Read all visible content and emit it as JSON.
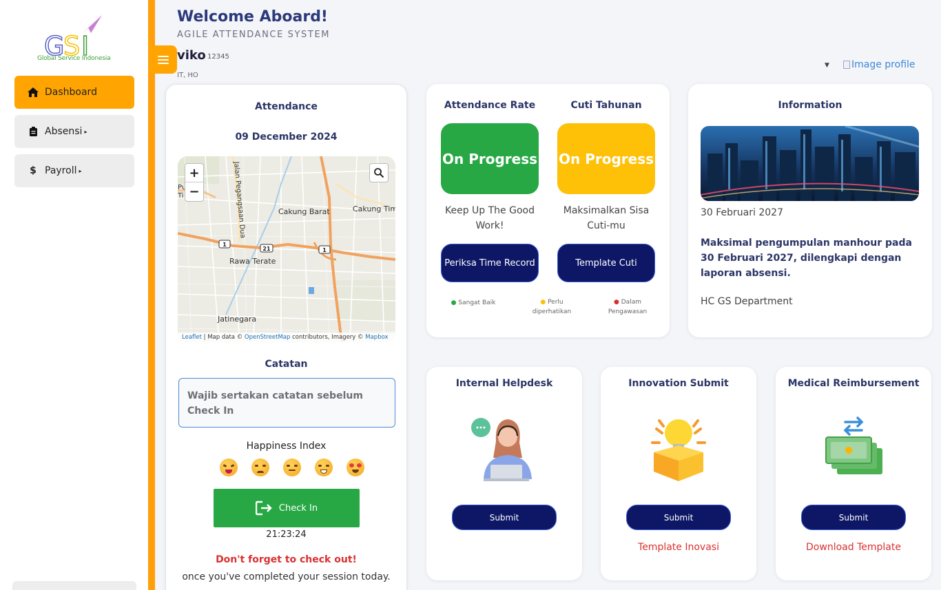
{
  "brand": {
    "logo_letters": "GSI",
    "logo_text": "Global Service Indonesia"
  },
  "sidebar": {
    "items": [
      {
        "label": "Dashboard",
        "icon": "home-icon",
        "active": true
      },
      {
        "label": "Absensi",
        "icon": "clipboard-icon",
        "has_submenu": true
      },
      {
        "label": "Payroll",
        "icon": "dollar-icon",
        "has_submenu": true
      }
    ],
    "caret": "▸"
  },
  "header": {
    "welcome": "Welcome Aboard!",
    "subtitle": "AGILE ATTENDANCE SYSTEM",
    "user_name": "viko",
    "user_id": "12345",
    "user_dept": "IT, HO",
    "profile_alt": "Image profile",
    "profile_caret": "▼"
  },
  "attendance": {
    "title": "Attendance",
    "date": "09 December 2024",
    "map": {
      "zoom_in": "+",
      "zoom_out": "−",
      "labels": [
        "Jalan Pegangsaan Dua",
        "Cakung Barat",
        "Cakung Tim",
        "Rawa Terate",
        "Jatinegara",
        "1",
        "21",
        "1",
        "1"
      ],
      "attribution_leaflet": "Leaflet",
      "attribution_mid": " | Map data © ",
      "attribution_osm": "OpenStreetMap",
      "attribution_mid2": " contributors, Imagery © ",
      "attribution_mapbox": "Mapbox"
    },
    "notes_title": "Catatan",
    "notes_placeholder": "Wajib sertakan catatan sebelum Check In",
    "happiness_title": "Happiness Index",
    "check_in_label": "Check In",
    "clock": "21:23:24",
    "reminder": "Don't forget to check out!",
    "reminder_sub": "once you've completed your session today."
  },
  "rate": {
    "attendance_title": "Attendance Rate",
    "attendance_status": "On Progress",
    "attendance_msg": "Keep Up The Good Work!",
    "attendance_button": "Periksa Time Record",
    "cuti_title": "Cuti Tahunan",
    "cuti_status": "On Progress",
    "cuti_msg": "Maksimalkan Sisa Cuti-mu",
    "cuti_button": "Template Cuti",
    "legend": [
      {
        "label": "Sangat Baik",
        "color": "#27a844"
      },
      {
        "label": "Perlu diperhatikan",
        "color": "#fec107"
      },
      {
        "label": "Dalam Pengawasan",
        "color": "#d9302f"
      }
    ]
  },
  "information": {
    "title": "Information",
    "date": "30 Februari 2027",
    "text": "Maksimal pengumpulan manhour pada 30 Februari 2027, dilengkapi dengan laporan absensi.",
    "dept": "HC GS Department"
  },
  "cards": [
    {
      "title": "Internal Helpdesk",
      "button": "Submit",
      "link": ""
    },
    {
      "title": "Innovation Submit",
      "button": "Submit",
      "link": "Template Inovasi"
    },
    {
      "title": "Medical Reimbursement",
      "button": "Submit",
      "link": "Download Template"
    }
  ],
  "colors": {
    "accent": "#ffa400",
    "rail": "#ff9f0a",
    "navy": "#0e1766",
    "green": "#27a844",
    "yellow": "#fec107",
    "red": "#d9302f",
    "title": "#2b3a7a"
  }
}
